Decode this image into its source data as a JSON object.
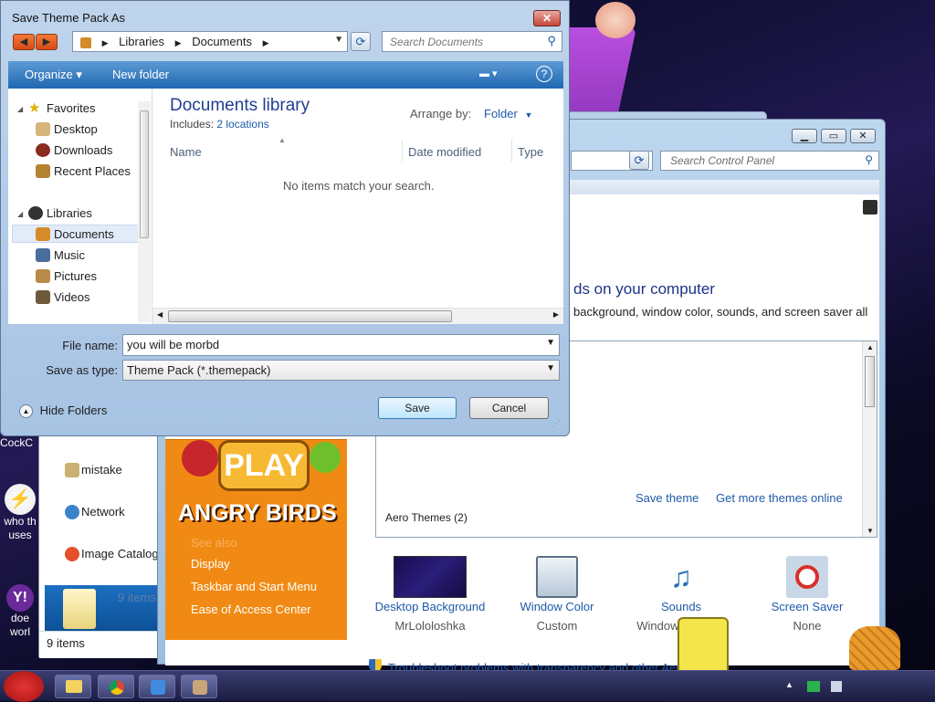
{
  "dialog": {
    "title": "Save Theme Pack As",
    "close_glyph": "✕",
    "breadcrumb": [
      "Libraries",
      "Documents"
    ],
    "search_placeholder": "Search Documents",
    "toolbar": {
      "organize": "Organize ▾",
      "new_folder": "New folder"
    },
    "nav": {
      "favorites": "Favorites",
      "desktop": "Desktop",
      "downloads": "Downloads",
      "recent_places": "Recent Places",
      "libraries": "Libraries",
      "documents": "Documents",
      "music": "Music",
      "pictures": "Pictures",
      "videos": "Videos"
    },
    "library_title": "Documents library",
    "includes_label": "Includes:",
    "includes_link": "2 locations",
    "arrange_label": "Arrange by:",
    "arrange_value": "Folder",
    "columns": [
      "Name",
      "Date modified",
      "Type"
    ],
    "empty_message": "No items match your search.",
    "file_name_label": "File name:",
    "file_name_value": "you will be morbd",
    "save_type_label": "Save as type:",
    "save_type_value": "Theme Pack (*.themepack)",
    "save_button": "Save",
    "cancel_button": "Cancel",
    "hide_folders": "Hide Folders"
  },
  "control_panel": {
    "search_placeholder": "Search Control Panel",
    "heading": "ds on your computer",
    "description": "background, window color, sounds, and screen saver all",
    "save_theme": "Save theme",
    "get_more_themes": "Get more themes online",
    "aero_themes": "Aero Themes (2)",
    "side_links": [
      "See also",
      "Display",
      "Taskbar and Start Menu",
      "Ease of Access Center"
    ],
    "ab_logo_text": [
      "PLAY",
      "ANGRY BIRDS"
    ],
    "tiles": [
      {
        "label": "Desktop Background",
        "sub": "MrLololoshka"
      },
      {
        "label": "Window Color",
        "sub": "Custom"
      },
      {
        "label": "Sounds",
        "sub": "Windows Default"
      },
      {
        "label": "Screen Saver",
        "sub": "None"
      }
    ],
    "troubleshoot": "Troubleshoot problems with transparency and other Aero effects"
  },
  "explorer": {
    "items": [
      "mistake",
      "Network",
      "Image Catalog"
    ],
    "selected_count_text": "9 items",
    "status": "9 items"
  },
  "desktop": {
    "icon_texts": [
      "CockC",
      "who th\nuses",
      "doe\nworl"
    ]
  },
  "colors": {
    "title_blue": "#1e3f91",
    "link_blue": "#1e5aa8",
    "orange": "#f18a14",
    "cmdbar": "#1f67b1"
  }
}
